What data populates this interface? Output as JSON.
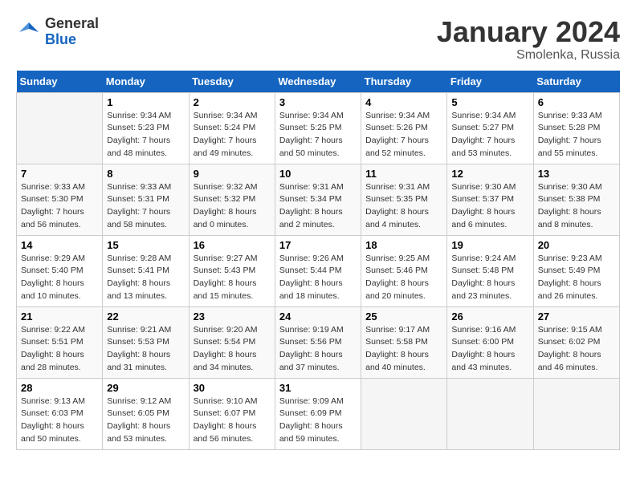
{
  "header": {
    "logo_general": "General",
    "logo_blue": "Blue",
    "title": "January 2024",
    "location": "Smolenka, Russia"
  },
  "columns": [
    "Sunday",
    "Monday",
    "Tuesday",
    "Wednesday",
    "Thursday",
    "Friday",
    "Saturday"
  ],
  "weeks": [
    [
      {
        "day": "",
        "info": ""
      },
      {
        "day": "1",
        "info": "Sunrise: 9:34 AM\nSunset: 5:23 PM\nDaylight: 7 hours\nand 48 minutes."
      },
      {
        "day": "2",
        "info": "Sunrise: 9:34 AM\nSunset: 5:24 PM\nDaylight: 7 hours\nand 49 minutes."
      },
      {
        "day": "3",
        "info": "Sunrise: 9:34 AM\nSunset: 5:25 PM\nDaylight: 7 hours\nand 50 minutes."
      },
      {
        "day": "4",
        "info": "Sunrise: 9:34 AM\nSunset: 5:26 PM\nDaylight: 7 hours\nand 52 minutes."
      },
      {
        "day": "5",
        "info": "Sunrise: 9:34 AM\nSunset: 5:27 PM\nDaylight: 7 hours\nand 53 minutes."
      },
      {
        "day": "6",
        "info": "Sunrise: 9:33 AM\nSunset: 5:28 PM\nDaylight: 7 hours\nand 55 minutes."
      }
    ],
    [
      {
        "day": "7",
        "info": "Sunrise: 9:33 AM\nSunset: 5:30 PM\nDaylight: 7 hours\nand 56 minutes."
      },
      {
        "day": "8",
        "info": "Sunrise: 9:33 AM\nSunset: 5:31 PM\nDaylight: 7 hours\nand 58 minutes."
      },
      {
        "day": "9",
        "info": "Sunrise: 9:32 AM\nSunset: 5:32 PM\nDaylight: 8 hours\nand 0 minutes."
      },
      {
        "day": "10",
        "info": "Sunrise: 9:31 AM\nSunset: 5:34 PM\nDaylight: 8 hours\nand 2 minutes."
      },
      {
        "day": "11",
        "info": "Sunrise: 9:31 AM\nSunset: 5:35 PM\nDaylight: 8 hours\nand 4 minutes."
      },
      {
        "day": "12",
        "info": "Sunrise: 9:30 AM\nSunset: 5:37 PM\nDaylight: 8 hours\nand 6 minutes."
      },
      {
        "day": "13",
        "info": "Sunrise: 9:30 AM\nSunset: 5:38 PM\nDaylight: 8 hours\nand 8 minutes."
      }
    ],
    [
      {
        "day": "14",
        "info": "Sunrise: 9:29 AM\nSunset: 5:40 PM\nDaylight: 8 hours\nand 10 minutes."
      },
      {
        "day": "15",
        "info": "Sunrise: 9:28 AM\nSunset: 5:41 PM\nDaylight: 8 hours\nand 13 minutes."
      },
      {
        "day": "16",
        "info": "Sunrise: 9:27 AM\nSunset: 5:43 PM\nDaylight: 8 hours\nand 15 minutes."
      },
      {
        "day": "17",
        "info": "Sunrise: 9:26 AM\nSunset: 5:44 PM\nDaylight: 8 hours\nand 18 minutes."
      },
      {
        "day": "18",
        "info": "Sunrise: 9:25 AM\nSunset: 5:46 PM\nDaylight: 8 hours\nand 20 minutes."
      },
      {
        "day": "19",
        "info": "Sunrise: 9:24 AM\nSunset: 5:48 PM\nDaylight: 8 hours\nand 23 minutes."
      },
      {
        "day": "20",
        "info": "Sunrise: 9:23 AM\nSunset: 5:49 PM\nDaylight: 8 hours\nand 26 minutes."
      }
    ],
    [
      {
        "day": "21",
        "info": "Sunrise: 9:22 AM\nSunset: 5:51 PM\nDaylight: 8 hours\nand 28 minutes."
      },
      {
        "day": "22",
        "info": "Sunrise: 9:21 AM\nSunset: 5:53 PM\nDaylight: 8 hours\nand 31 minutes."
      },
      {
        "day": "23",
        "info": "Sunrise: 9:20 AM\nSunset: 5:54 PM\nDaylight: 8 hours\nand 34 minutes."
      },
      {
        "day": "24",
        "info": "Sunrise: 9:19 AM\nSunset: 5:56 PM\nDaylight: 8 hours\nand 37 minutes."
      },
      {
        "day": "25",
        "info": "Sunrise: 9:17 AM\nSunset: 5:58 PM\nDaylight: 8 hours\nand 40 minutes."
      },
      {
        "day": "26",
        "info": "Sunrise: 9:16 AM\nSunset: 6:00 PM\nDaylight: 8 hours\nand 43 minutes."
      },
      {
        "day": "27",
        "info": "Sunrise: 9:15 AM\nSunset: 6:02 PM\nDaylight: 8 hours\nand 46 minutes."
      }
    ],
    [
      {
        "day": "28",
        "info": "Sunrise: 9:13 AM\nSunset: 6:03 PM\nDaylight: 8 hours\nand 50 minutes."
      },
      {
        "day": "29",
        "info": "Sunrise: 9:12 AM\nSunset: 6:05 PM\nDaylight: 8 hours\nand 53 minutes."
      },
      {
        "day": "30",
        "info": "Sunrise: 9:10 AM\nSunset: 6:07 PM\nDaylight: 8 hours\nand 56 minutes."
      },
      {
        "day": "31",
        "info": "Sunrise: 9:09 AM\nSunset: 6:09 PM\nDaylight: 8 hours\nand 59 minutes."
      },
      {
        "day": "",
        "info": ""
      },
      {
        "day": "",
        "info": ""
      },
      {
        "day": "",
        "info": ""
      }
    ]
  ]
}
